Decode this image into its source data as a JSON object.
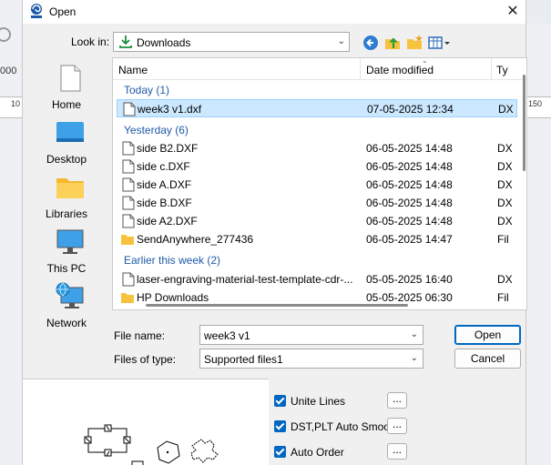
{
  "background": {
    "toolbar_number": "000",
    "ruler_left_label": "10",
    "ruler_right_label": "150"
  },
  "dialog": {
    "title": "Open",
    "app_icon": "app-logo-icon"
  },
  "look_in": {
    "label": "Look in:",
    "value": "Downloads",
    "icon": "download-folder-icon"
  },
  "toolbar": {
    "back": "back-arrow-icon",
    "up": "up-folder-icon",
    "new_folder": "new-folder-icon",
    "view_menu": "view-menu-icon"
  },
  "places": [
    {
      "label": "Home",
      "icon": "home-icon"
    },
    {
      "label": "Desktop",
      "icon": "desktop-icon"
    },
    {
      "label": "Libraries",
      "icon": "libraries-icon"
    },
    {
      "label": "This PC",
      "icon": "pc-icon"
    },
    {
      "label": "Network",
      "icon": "network-icon"
    }
  ],
  "file_list": {
    "columns": {
      "name": "Name",
      "date": "Date modified",
      "type": "Ty"
    },
    "groups": [
      {
        "label": "Today (1)"
      },
      {
        "label": "Yesterday (6)"
      },
      {
        "label": "Earlier this week (2)"
      }
    ],
    "rows": [
      {
        "name": "week3 v1.dxf",
        "date": "07-05-2025 12:34",
        "type": "DX",
        "kind": "file",
        "selected": true
      },
      {
        "name": "side B2.DXF",
        "date": "06-05-2025 14:48",
        "type": "DX",
        "kind": "file"
      },
      {
        "name": "side c.DXF",
        "date": "06-05-2025 14:48",
        "type": "DX",
        "kind": "file"
      },
      {
        "name": "side A.DXF",
        "date": "06-05-2025 14:48",
        "type": "DX",
        "kind": "file"
      },
      {
        "name": "side B.DXF",
        "date": "06-05-2025 14:48",
        "type": "DX",
        "kind": "file"
      },
      {
        "name": "side A2.DXF",
        "date": "06-05-2025 14:48",
        "type": "DX",
        "kind": "file"
      },
      {
        "name": "SendAnywhere_277436",
        "date": "06-05-2025 14:47",
        "type": "Fil",
        "kind": "folder"
      },
      {
        "name": "laser-engraving-material-test-template-cdr-...",
        "date": "05-05-2025 16:40",
        "type": "DX",
        "kind": "file"
      },
      {
        "name": "HP Downloads",
        "date": "05-05-2025 06:30",
        "type": "Fil",
        "kind": "folder"
      }
    ]
  },
  "file_name": {
    "label": "File name:",
    "value": "week3 v1"
  },
  "file_type": {
    "label": "Files of type:",
    "value": "Supported files1"
  },
  "buttons": {
    "open": "Open",
    "cancel": "Cancel"
  },
  "options": [
    {
      "label": "Unite Lines",
      "checked": true,
      "button": "..."
    },
    {
      "label": "DST,PLT Auto Smooth",
      "checked": true,
      "button": "..."
    },
    {
      "label": "Auto Order",
      "checked": true,
      "button": "..."
    }
  ],
  "colors": {
    "accent": "#0067c0",
    "selection": "#cce8ff",
    "group_header": "#1e5aa8",
    "folder": "#f8c33c"
  }
}
